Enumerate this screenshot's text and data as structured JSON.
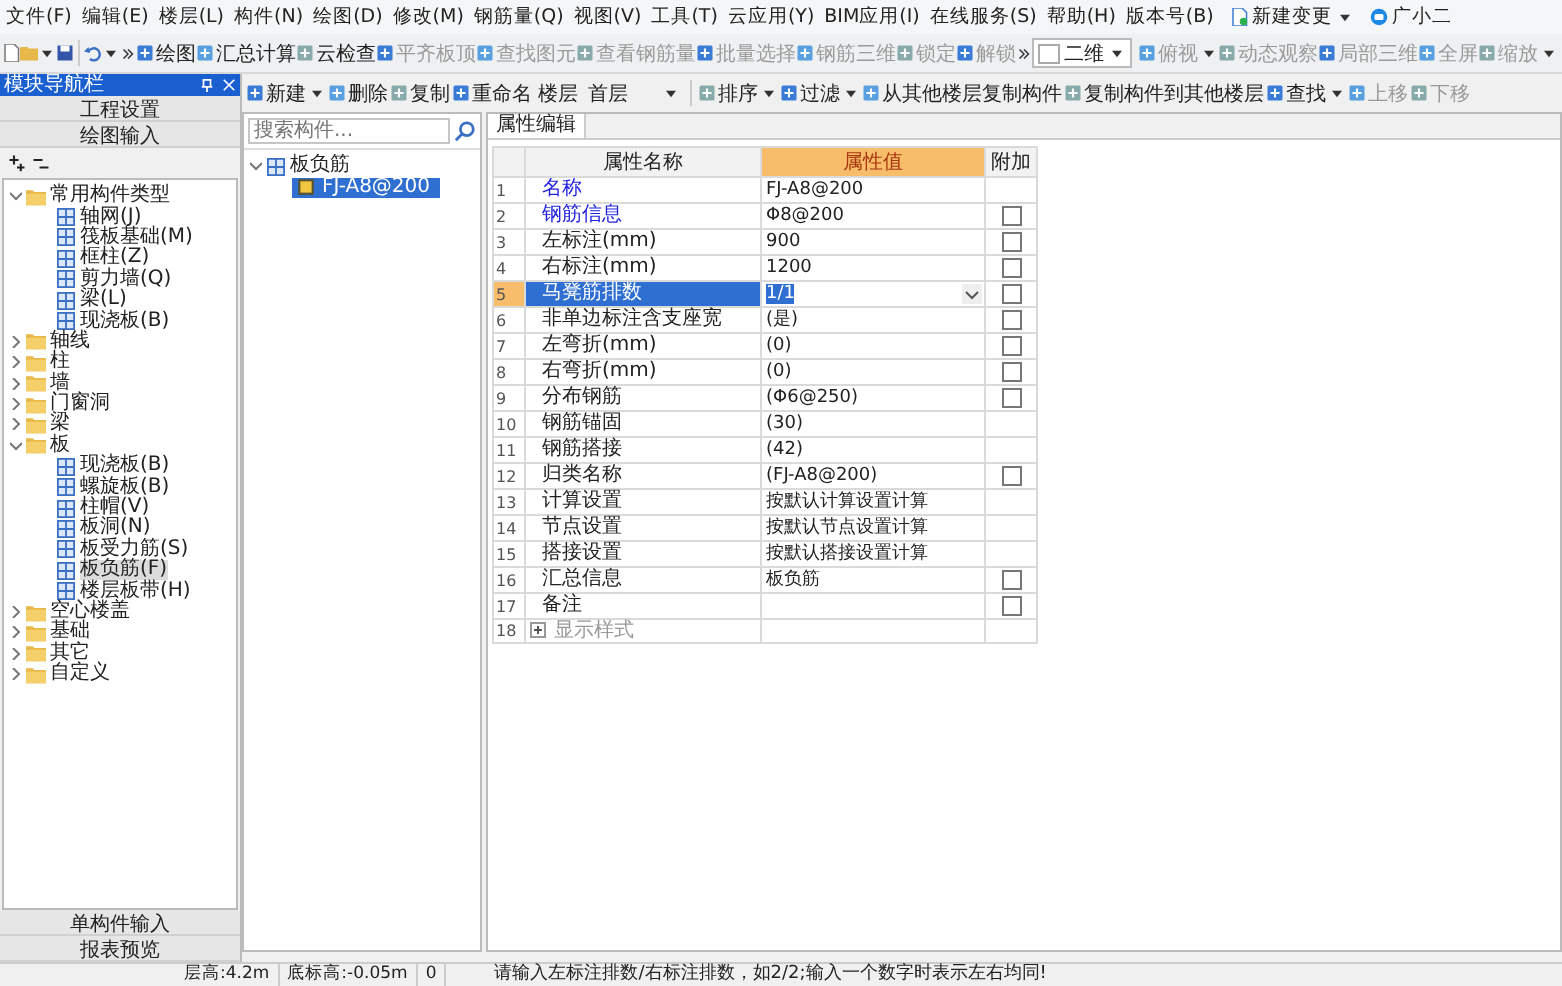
{
  "menu": [
    "文件(F)",
    "编辑(E)",
    "楼层(L)",
    "构件(N)",
    "绘图(D)",
    "修改(M)",
    "钢筋量(Q)",
    "视图(V)",
    "工具(T)",
    "云应用(Y)",
    "BIM应用(I)",
    "在线服务(S)",
    "帮助(H)",
    "版本号(B)"
  ],
  "menu_extras": [
    {
      "label": "新建变更",
      "dropdown": true
    },
    {
      "label": "广小二",
      "dropdown": false
    }
  ],
  "toolbar": [
    {
      "label": "绘图",
      "disabled": false,
      "dropdown": false
    },
    {
      "label": "汇总计算",
      "disabled": false,
      "dropdown": false
    },
    {
      "label": "云检查",
      "disabled": false,
      "dropdown": false
    },
    {
      "label": "平齐板顶",
      "disabled": true,
      "dropdown": false
    },
    {
      "label": "查找图元",
      "disabled": true,
      "dropdown": false
    },
    {
      "label": "查看钢筋量",
      "disabled": true,
      "dropdown": false
    },
    {
      "label": "批量选择",
      "disabled": true,
      "dropdown": false
    },
    {
      "label": "钢筋三维",
      "disabled": true,
      "dropdown": false
    },
    {
      "label": "锁定",
      "disabled": true,
      "dropdown": false
    },
    {
      "label": "解锁",
      "disabled": true,
      "dropdown": false
    }
  ],
  "view_toolbar": {
    "mode": "二维",
    "items": [
      {
        "label": "俯视",
        "dropdown": true
      },
      {
        "label": "动态观察",
        "dropdown": false
      },
      {
        "label": "局部三维",
        "dropdown": false
      },
      {
        "label": "全屏",
        "dropdown": false
      },
      {
        "label": "缩放",
        "dropdown": true
      }
    ]
  },
  "navigator": {
    "title": "模块导航栏",
    "top_buttons": [
      "工程设置",
      "绘图输入"
    ],
    "bottom_buttons": [
      "单构件输入",
      "报表预览"
    ],
    "tree": [
      {
        "label": "常用构件类型",
        "expanded": true,
        "children": [
          {
            "label": "轴网(J)",
            "selected": false
          },
          {
            "label": "筏板基础(M)",
            "selected": false
          },
          {
            "label": "框柱(Z)",
            "selected": false
          },
          {
            "label": "剪力墙(Q)",
            "selected": false
          },
          {
            "label": "梁(L)",
            "selected": false
          },
          {
            "label": "现浇板(B)",
            "selected": false
          }
        ]
      },
      {
        "label": "轴线",
        "expanded": false,
        "selected": false
      },
      {
        "label": "柱",
        "expanded": false,
        "selected": false
      },
      {
        "label": "墙",
        "expanded": false,
        "selected": false
      },
      {
        "label": "门窗洞",
        "expanded": false,
        "selected": false
      },
      {
        "label": "梁",
        "expanded": false,
        "selected": false
      },
      {
        "label": "板",
        "expanded": true,
        "children": [
          {
            "label": "现浇板(B)",
            "selected": false
          },
          {
            "label": "螺旋板(B)",
            "selected": false
          },
          {
            "label": "柱帽(V)",
            "selected": false
          },
          {
            "label": "板洞(N)",
            "selected": false
          },
          {
            "label": "板受力筋(S)",
            "selected": false
          },
          {
            "label": "板负筋(F)",
            "selected": true
          },
          {
            "label": "楼层板带(H)",
            "selected": false
          }
        ]
      },
      {
        "label": "空心楼盖",
        "expanded": false,
        "selected": false
      },
      {
        "label": "基础",
        "expanded": false,
        "selected": false
      },
      {
        "label": "其它",
        "expanded": false,
        "selected": false
      },
      {
        "label": "自定义",
        "expanded": false,
        "selected": false
      }
    ]
  },
  "component_toolbar": {
    "items": [
      {
        "label": "新建",
        "dropdown": true,
        "disabled": false
      },
      {
        "label": "删除",
        "dropdown": false,
        "disabled": false
      },
      {
        "label": "复制",
        "dropdown": false,
        "disabled": false
      },
      {
        "label": "重命名",
        "dropdown": false,
        "disabled": false
      }
    ],
    "floor_label": "楼层",
    "floor": "首层",
    "items2": [
      {
        "label": "排序",
        "dropdown": true,
        "disabled": false
      },
      {
        "label": "过滤",
        "dropdown": true,
        "disabled": false
      },
      {
        "label": "从其他楼层复制构件",
        "dropdown": false,
        "disabled": false
      },
      {
        "label": "复制构件到其他楼层",
        "dropdown": false,
        "disabled": false
      },
      {
        "label": "查找",
        "dropdown": true,
        "disabled": false
      },
      {
        "label": "上移",
        "dropdown": false,
        "disabled": true
      },
      {
        "label": "下移",
        "dropdown": false,
        "disabled": true
      }
    ]
  },
  "component_list": {
    "search": {
      "placeholder": "搜索构件..."
    },
    "tree": [
      {
        "label": "板负筋",
        "expanded": true,
        "children": [
          {
            "label": "FJ-A8@200",
            "selected": true
          }
        ]
      }
    ]
  },
  "properties": {
    "tab": "属性编辑",
    "columns": [
      "属性名称",
      "属性值",
      "附加"
    ],
    "rows": [
      {
        "index": "1",
        "name": "名称",
        "value": "FJ-A8@200",
        "emphasized": true,
        "selected": false
      },
      {
        "index": "2",
        "name": "钢筋信息",
        "value": "Φ8@200",
        "emphasized": true,
        "selected": false,
        "checked": false
      },
      {
        "index": "3",
        "name": "左标注(mm)",
        "value": "900",
        "emphasized": false,
        "selected": false,
        "checked": false
      },
      {
        "index": "4",
        "name": "右标注(mm)",
        "value": "1200",
        "emphasized": false,
        "selected": false,
        "checked": false
      },
      {
        "index": "5",
        "name": "马凳筋排数",
        "value": "1/1",
        "emphasized": false,
        "selected": true,
        "checked": false,
        "dropdown": true
      },
      {
        "index": "6",
        "name": "非单边标注含支座宽",
        "value": "(是)",
        "emphasized": false,
        "selected": false,
        "checked": false
      },
      {
        "index": "7",
        "name": "左弯折(mm)",
        "value": "(0)",
        "emphasized": false,
        "selected": false,
        "checked": false
      },
      {
        "index": "8",
        "name": "右弯折(mm)",
        "value": "(0)",
        "emphasized": false,
        "selected": false,
        "checked": false
      },
      {
        "index": "9",
        "name": "分布钢筋",
        "value": "(Φ6@250)",
        "emphasized": false,
        "selected": false,
        "checked": false
      },
      {
        "index": "10",
        "name": "钢筋锚固",
        "value": "(30)",
        "emphasized": false,
        "selected": false
      },
      {
        "index": "11",
        "name": "钢筋搭接",
        "value": "(42)",
        "emphasized": false,
        "selected": false
      },
      {
        "index": "12",
        "name": "归类名称",
        "value": "(FJ-A8@200)",
        "emphasized": false,
        "selected": false,
        "checked": false
      },
      {
        "index": "13",
        "name": "计算设置",
        "value": "按默认计算设置计算",
        "emphasized": false,
        "selected": false
      },
      {
        "index": "14",
        "name": "节点设置",
        "value": "按默认节点设置计算",
        "emphasized": false,
        "selected": false
      },
      {
        "index": "15",
        "name": "搭接设置",
        "value": "按默认搭接设置计算",
        "emphasized": false,
        "selected": false
      },
      {
        "index": "16",
        "name": "汇总信息",
        "value": "板负筋",
        "emphasized": false,
        "selected": false,
        "checked": false
      },
      {
        "index": "17",
        "name": "备注",
        "value": "",
        "emphasized": false,
        "selected": false,
        "checked": false
      },
      {
        "index": "18",
        "name": "显示样式",
        "expandable": true,
        "expanded": false,
        "emphasized": false,
        "selected": false
      }
    ]
  },
  "status_bar": [
    "层高:4.2m",
    "底标高:-0.05m",
    "0",
    "请输入左标注排数/右标注排数，如2/2;输入一个数字时表示左右均同!"
  ]
}
